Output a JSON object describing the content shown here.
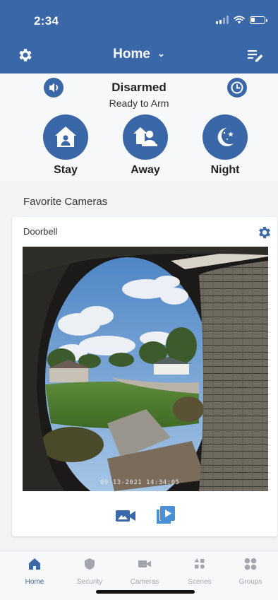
{
  "status_bar": {
    "time": "2:34",
    "signal_icon": "cellular-signal-icon",
    "wifi_icon": "wifi-icon",
    "battery_icon": "battery-low-icon"
  },
  "header": {
    "title": "Home",
    "settings_icon": "gear-icon",
    "dropdown_icon": "chevron-down-icon",
    "edit_icon": "edit-list-icon",
    "background": "#3a67a8"
  },
  "arm_panel": {
    "status": "Disarmed",
    "substatus": "Ready to Arm",
    "sound_icon": "speaker-icon",
    "history_icon": "clock-icon",
    "modes": [
      {
        "label": "Stay",
        "icon": "house-person-icon"
      },
      {
        "label": "Away",
        "icon": "people-away-icon"
      },
      {
        "label": "Night",
        "icon": "moon-stars-icon"
      }
    ]
  },
  "favorites": {
    "title": "Favorite Cameras",
    "camera": {
      "name": "Doorbell",
      "timestamp": "09-13-2021 14:34:05",
      "settings_icon": "gear-icon",
      "record_icon": "video-camera-icon",
      "playback_icon": "playback-icon"
    }
  },
  "tabs": [
    {
      "label": "Home",
      "icon": "home-icon",
      "active": true
    },
    {
      "label": "Security",
      "icon": "shield-icon",
      "active": false
    },
    {
      "label": "Cameras",
      "icon": "video-camera-icon",
      "active": false
    },
    {
      "label": "Scenes",
      "icon": "scenes-icon",
      "active": false
    },
    {
      "label": "Groups",
      "icon": "groups-icon",
      "active": false
    }
  ],
  "colors": {
    "accent": "#3a67a8",
    "tab_inactive": "#a3a7ad"
  }
}
